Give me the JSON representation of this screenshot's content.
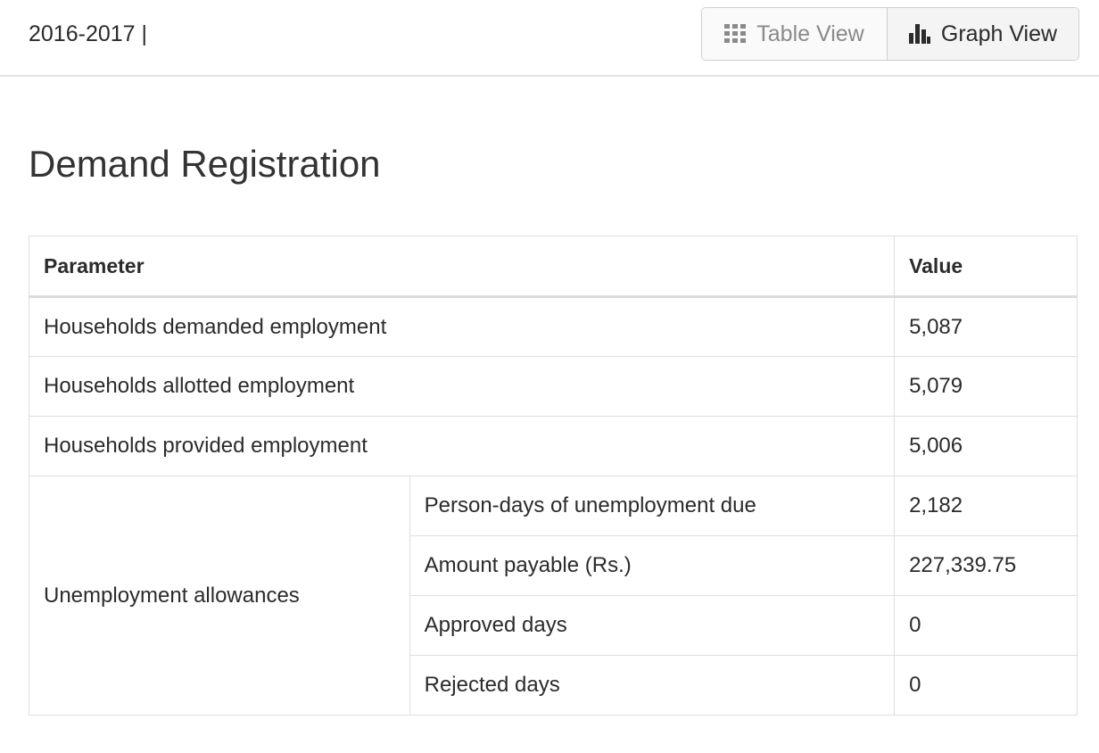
{
  "header": {
    "period": "2016-2017 |",
    "table_view_label": "Table View",
    "graph_view_label": "Graph View",
    "table_view_icon": "grid-icon",
    "graph_view_icon": "bar-chart-icon"
  },
  "main": {
    "title": "Demand Registration",
    "table": {
      "headers": [
        "Parameter",
        "Value"
      ],
      "rows": [
        {
          "parameter": "Households demanded employment",
          "value": "5,087"
        },
        {
          "parameter": "Households allotted employment",
          "value": "5,079"
        },
        {
          "parameter": "Households provided employment",
          "value": "5,006"
        }
      ],
      "group": {
        "label": "Unemployment allowances",
        "rows": [
          {
            "parameter": "Person-days of unemployment due",
            "value": "2,182"
          },
          {
            "parameter": "Amount payable (Rs.)",
            "value": "227,339.75"
          },
          {
            "parameter": "Approved days",
            "value": "0"
          },
          {
            "parameter": "Rejected days",
            "value": "0"
          }
        ]
      }
    }
  }
}
